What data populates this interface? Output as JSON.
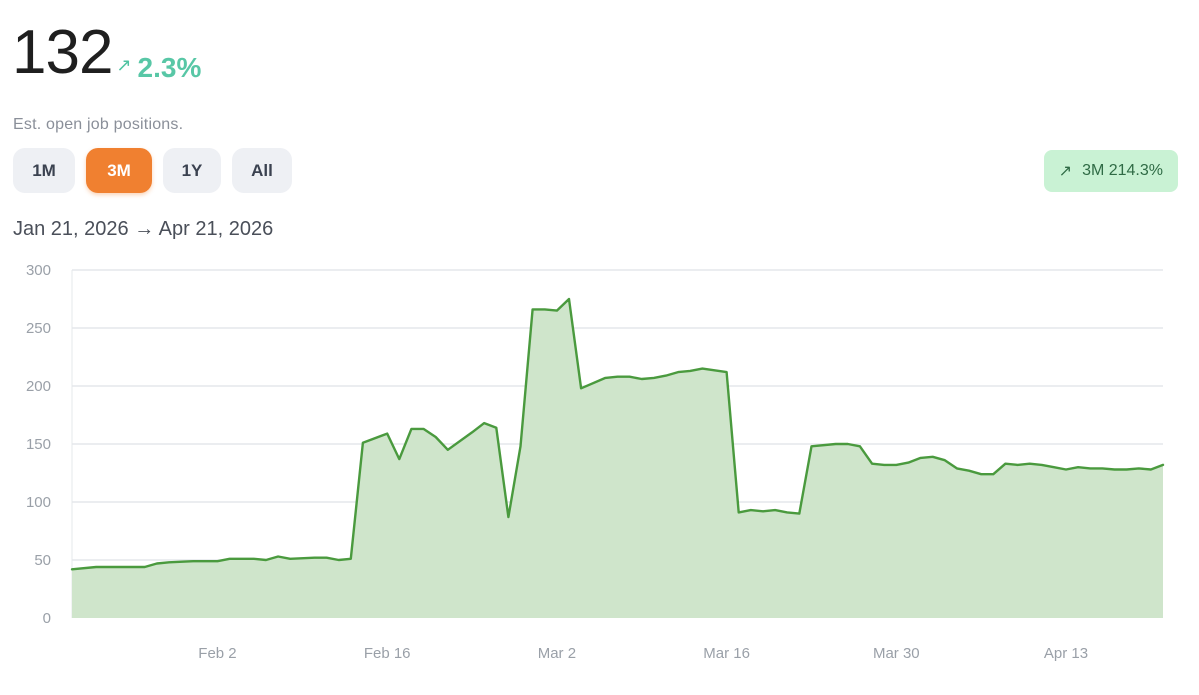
{
  "header": {
    "value": "132",
    "change_icon": "arrow-up-right-icon",
    "change_glyph": "↗",
    "change_pct": "2.3%",
    "subtitle": "Est. open job positions."
  },
  "range_buttons": [
    {
      "label": "1M",
      "active": false
    },
    {
      "label": "3M",
      "active": true
    },
    {
      "label": "1Y",
      "active": false
    },
    {
      "label": "All",
      "active": false
    }
  ],
  "change_badge": {
    "icon": "arrow-up-right-icon",
    "glyph": "↗",
    "label": "3M 214.3%"
  },
  "date_range": "Jan 21, 2026 → Apr 21, 2026",
  "colors": {
    "accent": "#f08030",
    "positive": "#58c7a6",
    "line": "#4a9a3e",
    "fill": "#cfe5cb",
    "badge_bg": "#c9f2d4"
  },
  "chart_data": {
    "type": "area",
    "x_start": "2026-01-21",
    "x_end": "2026-04-21",
    "ylim": [
      0,
      300
    ],
    "yticks": [
      0,
      50,
      100,
      150,
      200,
      250,
      300
    ],
    "xtick_labels": [
      "Feb 2",
      "Mar 2",
      "Feb 16",
      "Mar 16",
      "Mar 30",
      "Apr 13"
    ],
    "xtick_dates": [
      "2026-02-02",
      "2026-03-02",
      "2026-02-16",
      "2026-03-16",
      "2026-03-30",
      "2026-04-13"
    ],
    "grid": true,
    "series": [
      {
        "points": [
          [
            "2026-01-21",
            42
          ],
          [
            "2026-01-23",
            44
          ],
          [
            "2026-01-27",
            44
          ],
          [
            "2026-01-28",
            47
          ],
          [
            "2026-01-29",
            48
          ],
          [
            "2026-01-31",
            49
          ],
          [
            "2026-02-02",
            49
          ],
          [
            "2026-02-03",
            51
          ],
          [
            "2026-02-05",
            51
          ],
          [
            "2026-02-06",
            50
          ],
          [
            "2026-02-07",
            53
          ],
          [
            "2026-02-08",
            51
          ],
          [
            "2026-02-10",
            52
          ],
          [
            "2026-02-11",
            52
          ],
          [
            "2026-02-12",
            50
          ],
          [
            "2026-02-13",
            51
          ],
          [
            "2026-02-14",
            151
          ],
          [
            "2026-02-16",
            159
          ],
          [
            "2026-02-17",
            137
          ],
          [
            "2026-02-18",
            163
          ],
          [
            "2026-02-19",
            163
          ],
          [
            "2026-02-20",
            156
          ],
          [
            "2026-02-21",
            145
          ],
          [
            "2026-02-23",
            160
          ],
          [
            "2026-02-24",
            168
          ],
          [
            "2026-02-25",
            164
          ],
          [
            "2026-02-26",
            87
          ],
          [
            "2026-02-27",
            148
          ],
          [
            "2026-02-28",
            266
          ],
          [
            "2026-03-01",
            266
          ],
          [
            "2026-03-02",
            265
          ],
          [
            "2026-03-03",
            275
          ],
          [
            "2026-03-04",
            198
          ],
          [
            "2026-03-06",
            207
          ],
          [
            "2026-03-07",
            208
          ],
          [
            "2026-03-08",
            208
          ],
          [
            "2026-03-09",
            206
          ],
          [
            "2026-03-10",
            207
          ],
          [
            "2026-03-11",
            209
          ],
          [
            "2026-03-12",
            212
          ],
          [
            "2026-03-13",
            213
          ],
          [
            "2026-03-14",
            215
          ],
          [
            "2026-03-16",
            212
          ],
          [
            "2026-03-17",
            91
          ],
          [
            "2026-03-18",
            93
          ],
          [
            "2026-03-19",
            92
          ],
          [
            "2026-03-20",
            93
          ],
          [
            "2026-03-21",
            91
          ],
          [
            "2026-03-22",
            90
          ],
          [
            "2026-03-23",
            148
          ],
          [
            "2026-03-25",
            150
          ],
          [
            "2026-03-26",
            150
          ],
          [
            "2026-03-27",
            148
          ],
          [
            "2026-03-28",
            133
          ],
          [
            "2026-03-29",
            132
          ],
          [
            "2026-03-30",
            132
          ],
          [
            "2026-03-31",
            134
          ],
          [
            "2026-04-01",
            138
          ],
          [
            "2026-04-02",
            139
          ],
          [
            "2026-04-03",
            136
          ],
          [
            "2026-04-04",
            129
          ],
          [
            "2026-04-05",
            127
          ],
          [
            "2026-04-06",
            124
          ],
          [
            "2026-04-07",
            124
          ],
          [
            "2026-04-08",
            133
          ],
          [
            "2026-04-09",
            132
          ],
          [
            "2026-04-10",
            133
          ],
          [
            "2026-04-11",
            132
          ],
          [
            "2026-04-12",
            130
          ],
          [
            "2026-04-13",
            128
          ],
          [
            "2026-04-14",
            130
          ],
          [
            "2026-04-15",
            129
          ],
          [
            "2026-04-16",
            129
          ],
          [
            "2026-04-17",
            128
          ],
          [
            "2026-04-18",
            128
          ],
          [
            "2026-04-19",
            129
          ],
          [
            "2026-04-20",
            128
          ],
          [
            "2026-04-21",
            132
          ]
        ]
      }
    ]
  }
}
